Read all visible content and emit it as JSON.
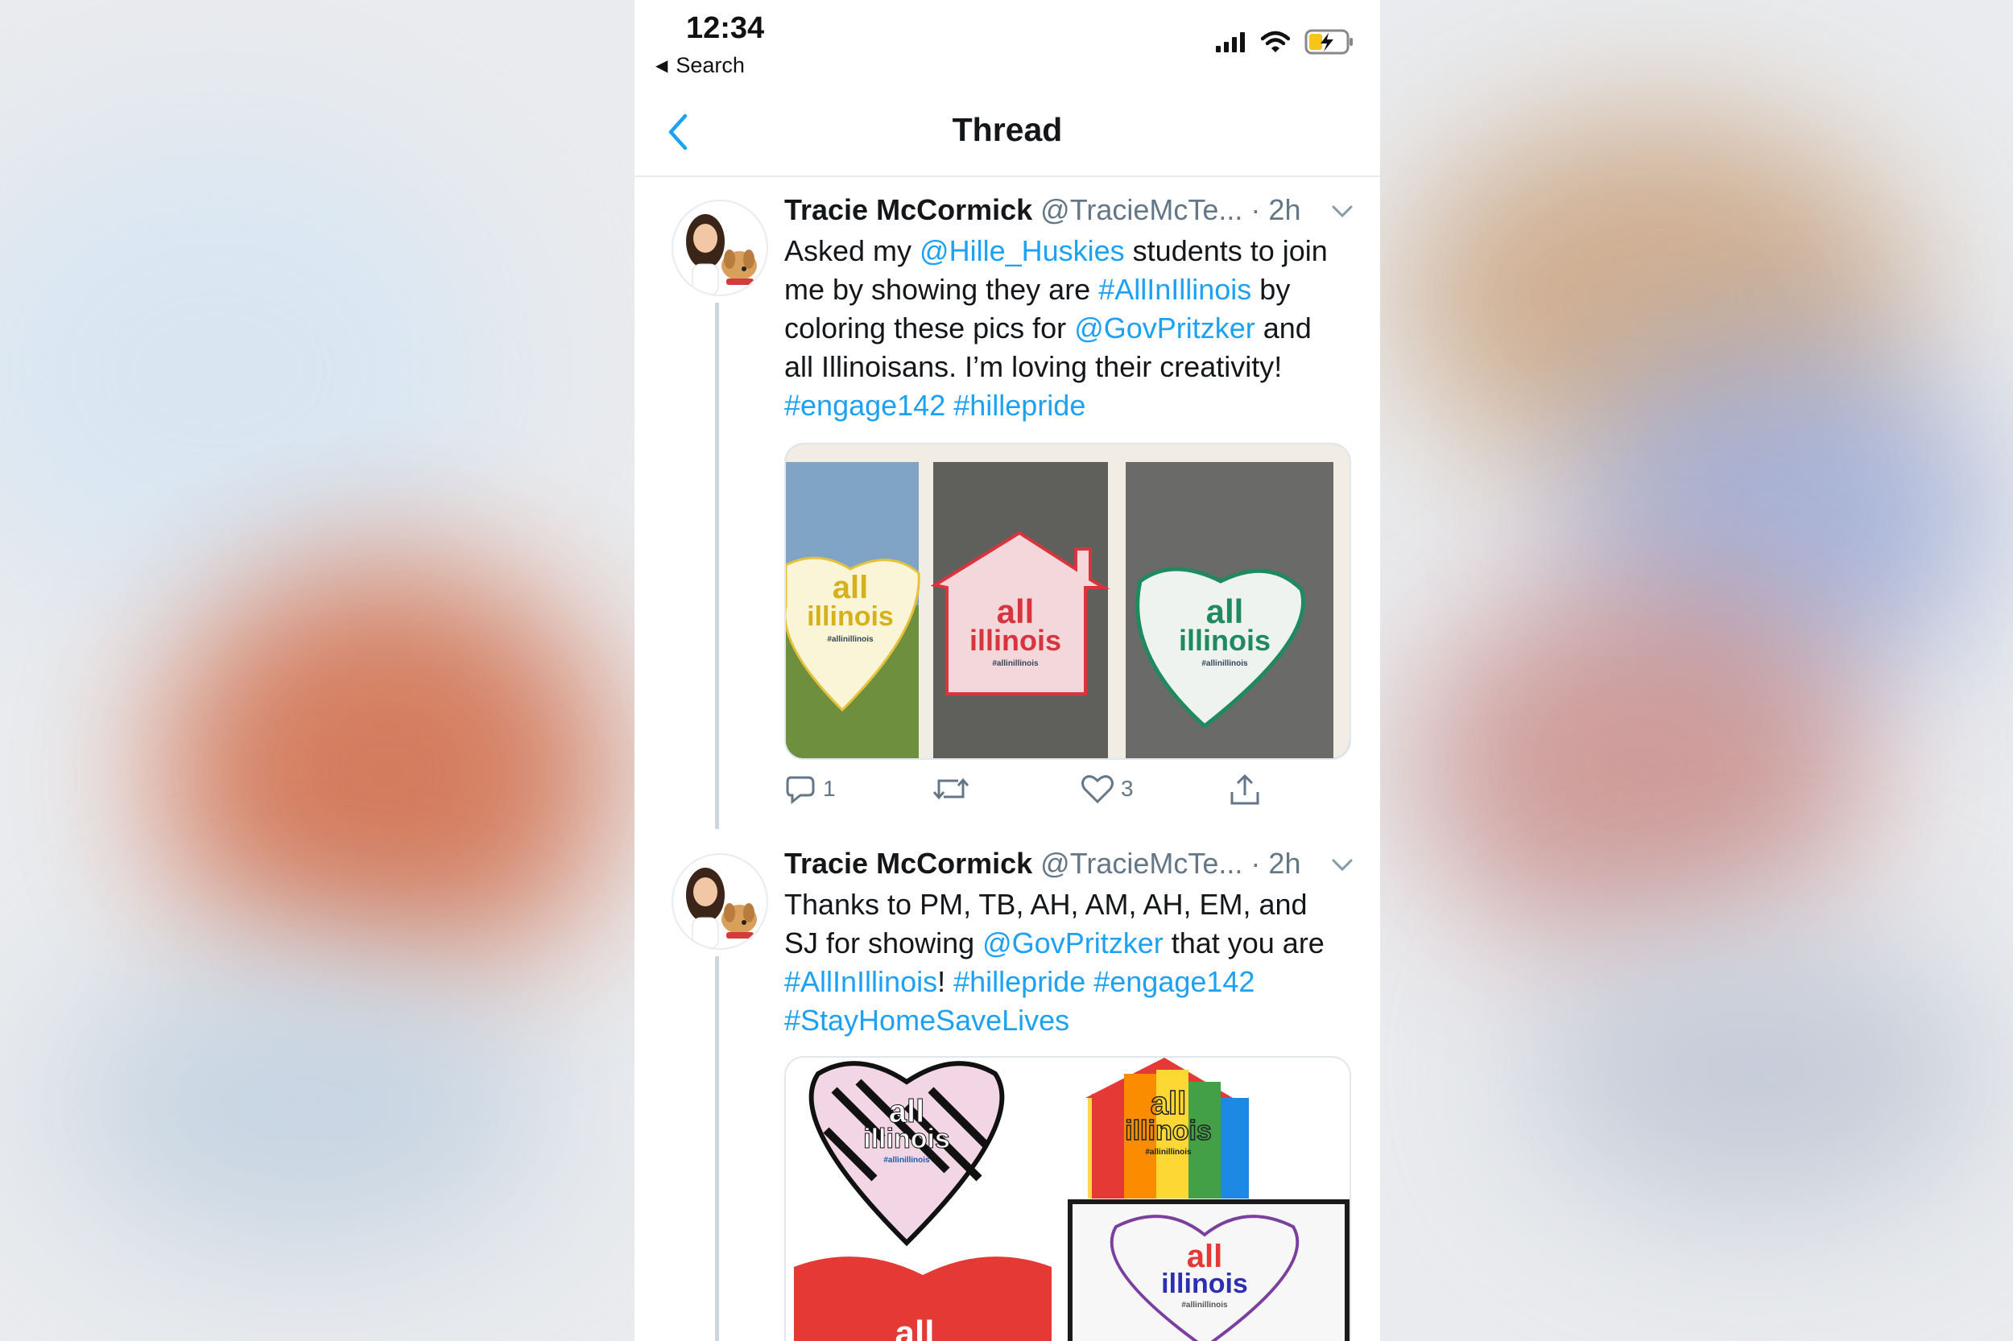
{
  "status_bar": {
    "time": "12:34",
    "back_app_label": "Search"
  },
  "nav": {
    "title": "Thread"
  },
  "tweets": [
    {
      "name": "Tracie McCormick",
      "handle": "@TracieMcTe...",
      "separator": " · ",
      "time": "2h",
      "text_segments": [
        {
          "t": "Asked my ",
          "link": false
        },
        {
          "t": "@Hille_Huskies",
          "link": true
        },
        {
          "t": " students to join me by showing they are ",
          "link": false
        },
        {
          "t": "#AllInIllinois",
          "link": true
        },
        {
          "t": " by coloring these pics for ",
          "link": false
        },
        {
          "t": "@GovPritzker",
          "link": true
        },
        {
          "t": " and all Illinoisans.  I’m loving their creativity! ",
          "link": false
        },
        {
          "t": "#engage142",
          "link": true
        },
        {
          "t": " ",
          "link": false
        },
        {
          "t": "#hillepride",
          "link": true
        }
      ],
      "media": {
        "panels": [
          {
            "line1": "all",
            "line2": "illinois",
            "tag": "#allinillinois"
          },
          {
            "line1": "all",
            "line2": "illinois",
            "tag": "#allinillinois"
          },
          {
            "line1": "all",
            "line2": "illinois",
            "tag": "#allinillinois"
          }
        ]
      },
      "actions": {
        "reply_count": "1",
        "retweet_count": "",
        "like_count": "3"
      }
    },
    {
      "name": "Tracie McCormick",
      "handle": "@TracieMcTe...",
      "separator": " · ",
      "time": "2h",
      "text_segments": [
        {
          "t": "Thanks to PM, TB, AH, AM, AH, EM, and SJ for showing ",
          "link": false
        },
        {
          "t": "@GovPritzker",
          "link": true
        },
        {
          "t": " that you are ",
          "link": false
        },
        {
          "t": "#AllInIllinois",
          "link": true
        },
        {
          "t": "! ",
          "link": false
        },
        {
          "t": "#hillepride",
          "link": true
        },
        {
          "t": " ",
          "link": false
        },
        {
          "t": "#engage142",
          "link": true
        },
        {
          "t": " ",
          "link": false
        },
        {
          "t": "#StayHomeSaveLives",
          "link": true
        }
      ],
      "media": {
        "panels": [
          {
            "line1": "all",
            "line2": "illinois",
            "tag": "#allinillinois"
          },
          {
            "line1": "all",
            "line2": "illinois",
            "tag": "#allinillinois"
          },
          {
            "line1": "all",
            "line2": "illinois",
            "tag": "#allinillinois"
          },
          {
            "line1": "all",
            "line2": "",
            "tag": ""
          }
        ]
      }
    }
  ],
  "colors": {
    "link": "#1da1f2",
    "text": "#14171a",
    "muted": "#657786"
  }
}
